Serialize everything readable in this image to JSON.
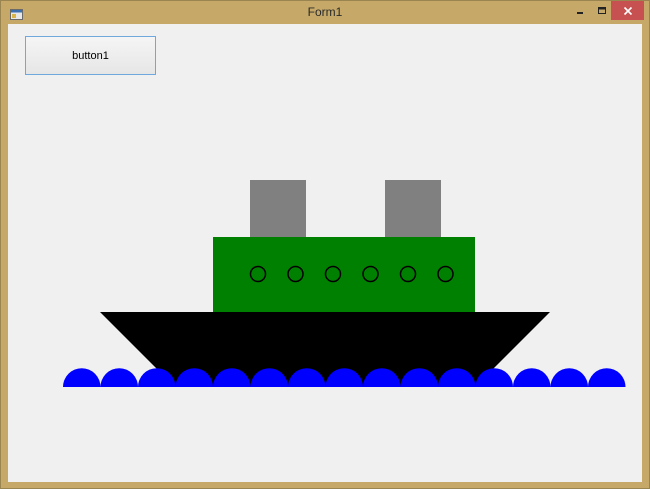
{
  "window": {
    "title": "Form1",
    "controls": [
      "minimize",
      "maximize",
      "close"
    ]
  },
  "form": {
    "button1_label": "button1"
  },
  "drawing": {
    "hull_color": "#000000",
    "cabin_color": "#008000",
    "chimney_color": "#808080",
    "porthole_count": 6,
    "wave_count": 15,
    "wave_color": "#0000ff"
  }
}
